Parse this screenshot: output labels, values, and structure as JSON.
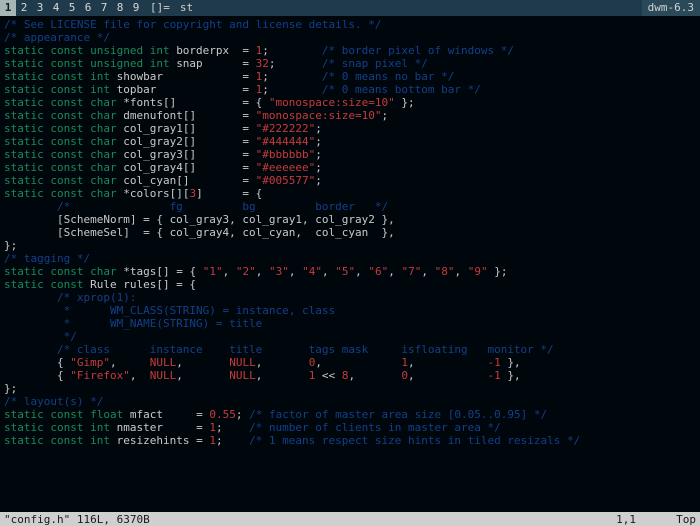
{
  "bar": {
    "tags": [
      "1",
      "2",
      "3",
      "4",
      "5",
      "6",
      "7",
      "8",
      "9"
    ],
    "selected_tag_index": 0,
    "layout_symbol": "[]=",
    "window_title": "st",
    "status": "dwm-6.3"
  },
  "code": {
    "l01": "/* See LICENSE file for copyright and license details. */",
    "l02": "",
    "l03": "/* appearance */",
    "l04a": "static const unsigned int ",
    "l04b": "borderpx  = ",
    "l04c": "1",
    "l04d": ";        ",
    "l04e": "/* border pixel of windows */",
    "l05a": "static const unsigned int ",
    "l05b": "snap      = ",
    "l05c": "32",
    "l05d": ";       ",
    "l05e": "/* snap pixel */",
    "l06a": "static const int ",
    "l06b": "showbar            = ",
    "l06c": "1",
    "l06d": ";        ",
    "l06e": "/* 0 means no bar */",
    "l07a": "static const int ",
    "l07b": "topbar             = ",
    "l07c": "1",
    "l07d": ";        ",
    "l07e": "/* 0 means bottom bar */",
    "l08a": "static const char ",
    "l08b": "*fonts[]          = { ",
    "l08c": "\"monospace:size=10\"",
    "l08d": " };",
    "l09a": "static const char ",
    "l09b": "dmenufont[]       = ",
    "l09c": "\"monospace:size=10\"",
    "l09d": ";",
    "l10a": "static const char ",
    "l10b": "col_gray1[]       = ",
    "l10c": "\"#222222\"",
    "l10d": ";",
    "l11a": "static const char ",
    "l11b": "col_gray2[]       = ",
    "l11c": "\"#444444\"",
    "l11d": ";",
    "l12a": "static const char ",
    "l12b": "col_gray3[]       = ",
    "l12c": "\"#bbbbbb\"",
    "l12d": ";",
    "l13a": "static const char ",
    "l13b": "col_gray4[]       = ",
    "l13c": "\"#eeeeee\"",
    "l13d": ";",
    "l14a": "static const char ",
    "l14b": "col_cyan[]        = ",
    "l14c": "\"#005577\"",
    "l14d": ";",
    "l15a": "static const char ",
    "l15b": "*colors[][",
    "l15c": "3",
    "l15d": "]      = {",
    "l16": "        /*               fg         bg         border   */",
    "l17": "        [SchemeNorm] = { col_gray3, col_gray1, col_gray2 },",
    "l18": "        [SchemeSel]  = { col_gray4, col_cyan,  col_cyan  },",
    "l19": "};",
    "l20": "",
    "l21": "/* tagging */",
    "l22a": "static const char ",
    "l22b": "*tags[] = { ",
    "l22t": [
      "\"1\"",
      "\"2\"",
      "\"3\"",
      "\"4\"",
      "\"5\"",
      "\"6\"",
      "\"7\"",
      "\"8\"",
      "\"9\""
    ],
    "l22c": " };",
    "l23": "",
    "l24a": "static const ",
    "l24b": "Rule rules[] = {",
    "l25": "        /* xprop(1):",
    "l26": "         *      WM_CLASS(STRING) = instance, class",
    "l27": "         *      WM_NAME(STRING) = title",
    "l28": "         */",
    "l29": "        /* class      instance    title       tags mask     isfloating   monitor */",
    "l30a": "        { ",
    "l30b": "\"Gimp\"",
    "l30c": ",     ",
    "l30d": "NULL",
    "l30e": ",       ",
    "l30f": "NULL",
    "l30g": ",       ",
    "l30h": "0",
    "l30i": ",            ",
    "l30j": "1",
    "l30k": ",           ",
    "l30l": "-1",
    "l30m": " },",
    "l31a": "        { ",
    "l31b": "\"Firefox\"",
    "l31c": ",  ",
    "l31d": "NULL",
    "l31e": ",       ",
    "l31f": "NULL",
    "l31g": ",       ",
    "l31h": "1",
    "l31h2": " << ",
    "l31h3": "8",
    "l31i": ",       ",
    "l31j": "0",
    "l31k": ",           ",
    "l31l": "-1",
    "l31m": " },",
    "l32": "};",
    "l33": "",
    "l34": "/* layout(s) */",
    "l35a": "static const float ",
    "l35b": "mfact     = ",
    "l35c": "0.55",
    "l35d": "; ",
    "l35e": "/* factor of master area size [0.05..0.95] */",
    "l36a": "static const int ",
    "l36b": "nmaster     = ",
    "l36c": "1",
    "l36d": ";    ",
    "l36e": "/* number of clients in master area */",
    "l37a": "static const int ",
    "l37b": "resizehints = ",
    "l37c": "1",
    "l37d": ";    ",
    "l37e": "/* 1 means respect size hints in tiled resizals */"
  },
  "statusline": {
    "left": "\"config.h\" 116L, 6370B",
    "mid": "1,1",
    "right": "Top"
  }
}
